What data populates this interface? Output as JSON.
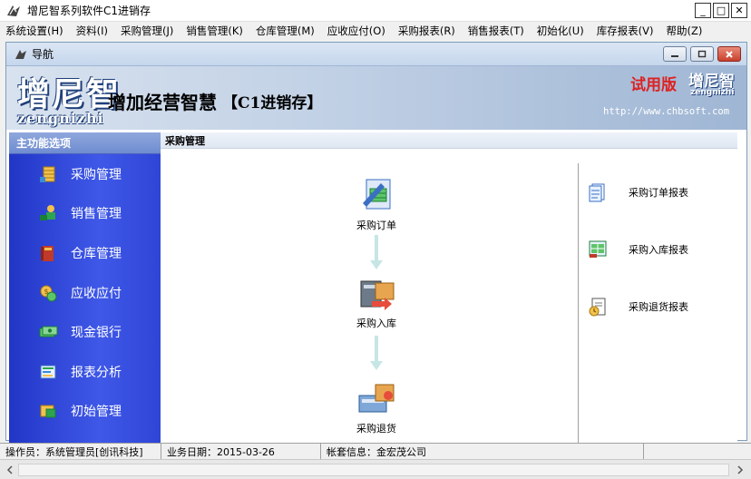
{
  "window": {
    "title": "增尼智系列软件C1进销存",
    "buttons": {
      "minimize": "_",
      "maximize": "□",
      "close": "✕"
    }
  },
  "menubar": [
    "系统设置(H)",
    "资料(I)",
    "采购管理(J)",
    "销售管理(K)",
    "仓库管理(M)",
    "应收应付(O)",
    "采购报表(R)",
    "销售报表(T)",
    "初始化(U)",
    "库存报表(V)",
    "帮助(Z)"
  ],
  "inner_window": {
    "title": "导航"
  },
  "banner": {
    "brand": "增尼智",
    "brand_latin": "zengnizhi",
    "slogan": "增加经营智慧",
    "product": "【C1进销存】",
    "edition": "试用版",
    "brand_small": "增尼智",
    "brand_small_latin": "zengnizhi",
    "url": "http://www.chbsoft.com"
  },
  "sidebar": {
    "header": "主功能选项",
    "items": [
      {
        "label": "采购管理",
        "icon": "coins-stack-icon"
      },
      {
        "label": "销售管理",
        "icon": "user-sales-icon"
      },
      {
        "label": "仓库管理",
        "icon": "warehouse-book-icon"
      },
      {
        "label": "应收应付",
        "icon": "money-bag-icon"
      },
      {
        "label": "现金银行",
        "icon": "cash-icon"
      },
      {
        "label": "报表分析",
        "icon": "report-chart-icon"
      },
      {
        "label": "初始管理",
        "icon": "init-settings-icon"
      }
    ]
  },
  "content": {
    "section_title": "采购管理",
    "flow": [
      {
        "label": "采购订单",
        "icon": "purchase-order-icon"
      },
      {
        "label": "采购入库",
        "icon": "purchase-inbound-icon"
      },
      {
        "label": "采购退货",
        "icon": "purchase-return-icon"
      }
    ],
    "reports": [
      {
        "label": "采购订单报表",
        "icon": "order-report-icon"
      },
      {
        "label": "采购入库报表",
        "icon": "inbound-report-icon"
      },
      {
        "label": "采购退货报表",
        "icon": "return-report-icon"
      }
    ]
  },
  "statusbar": {
    "operator": "操作员：系统管理员[创讯科技]",
    "date": "业务日期：2015-03-26",
    "account": "帐套信息：金宏茂公司"
  }
}
